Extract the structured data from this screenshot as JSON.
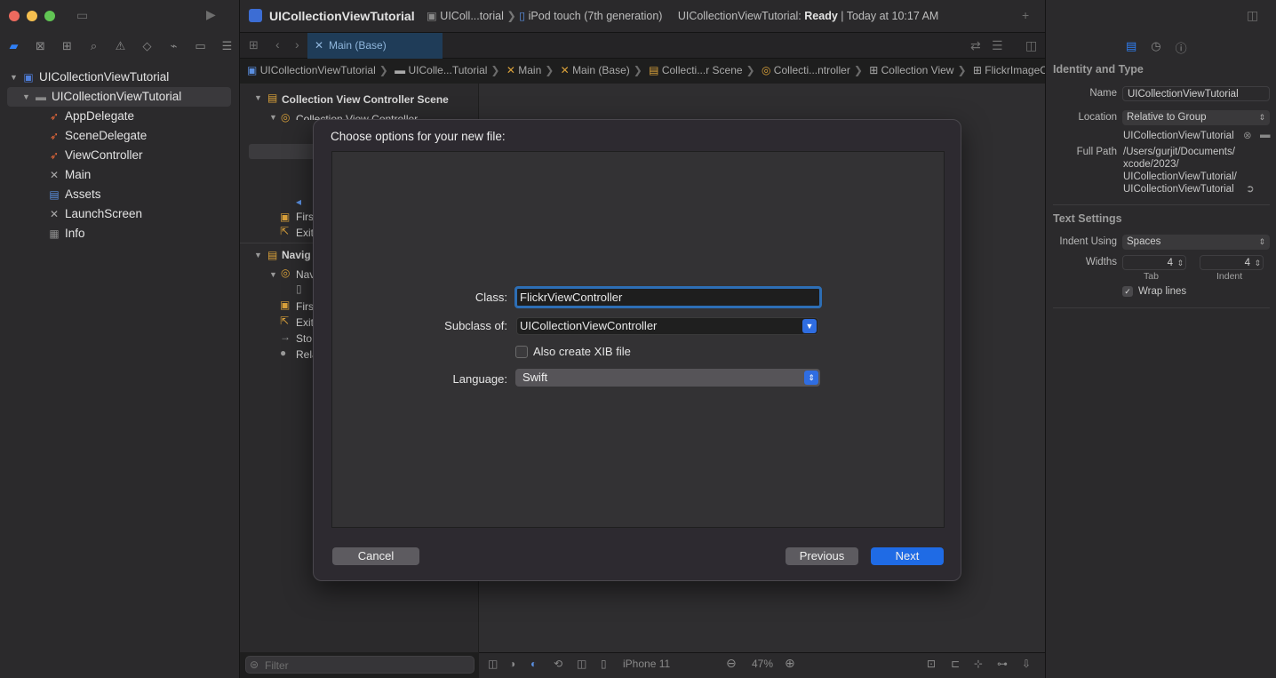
{
  "navigator": {
    "tree": [
      {
        "label": "UICollectionViewTutorial",
        "icon": "project-icon",
        "level": 0
      },
      {
        "label": "UICollectionViewTutorial",
        "icon": "folder-icon",
        "level": 1,
        "selected": true
      },
      {
        "label": "AppDelegate",
        "icon": "swift-file-icon",
        "level": 2
      },
      {
        "label": "SceneDelegate",
        "icon": "swift-file-icon",
        "level": 2
      },
      {
        "label": "ViewController",
        "icon": "swift-file-icon",
        "level": 2
      },
      {
        "label": "Main",
        "icon": "storyboard-icon",
        "level": 2
      },
      {
        "label": "Assets",
        "icon": "asset-catalog-icon",
        "level": 2
      },
      {
        "label": "LaunchScreen",
        "icon": "storyboard-icon",
        "level": 2
      },
      {
        "label": "Info",
        "icon": "plist-icon",
        "level": 2
      }
    ],
    "filter_placeholder": "Filter"
  },
  "toolbar": {
    "scheme_title": "UICollectionViewTutorial",
    "target_short": "UIColl...torial",
    "device": "iPod touch (7th generation)",
    "status_prefix": "UICollectionViewTutorial:",
    "status_state": "Ready",
    "status_time": "| Today at 10:17 AM"
  },
  "editor": {
    "tab_label": "Main (Base)",
    "breadcrumb": [
      "UICollectionViewTutorial",
      "UIColle...Tutorial",
      "Main",
      "Main (Base)",
      "Collecti...r Scene",
      "Collecti...ntroller",
      "Collection View",
      "FlickrImageCell"
    ],
    "outline": {
      "scene1": "Collection View Controller Scene",
      "scene1_controller": "Collection View Controller",
      "first_responder": "Firs",
      "exit": "Exit",
      "scene2": "Navig",
      "nav_item": "Navi",
      "storyboard_entry": "Sto",
      "relationship": "Rela"
    },
    "canvas_bar": {
      "device": "iPhone 11",
      "zoom": "47%"
    }
  },
  "inspector": {
    "identity_header": "Identity and Type",
    "name_label": "Name",
    "name_value": "UICollectionViewTutorial",
    "location_label": "Location",
    "location_value": "Relative to Group",
    "location_path": "UICollectionViewTutorial",
    "fullpath_label": "Full Path",
    "fullpath_lines": [
      "/Users/gurjit/Documents/",
      "xcode/2023/",
      "UICollectionViewTutorial/",
      "UICollectionViewTutorial"
    ],
    "text_settings_header": "Text Settings",
    "indent_using_label": "Indent Using",
    "indent_using_value": "Spaces",
    "widths_label": "Widths",
    "tab_value": "4",
    "indent_value": "4",
    "tab_caption": "Tab",
    "indent_caption": "Indent",
    "wrap_lines_label": "Wrap lines"
  },
  "sheet": {
    "title": "Choose options for your new file:",
    "class_label": "Class:",
    "class_value": "FlickrViewController",
    "subclass_label": "Subclass of:",
    "subclass_value": "UICollectionViewController",
    "xib_label": "Also create XIB file",
    "language_label": "Language:",
    "language_value": "Swift",
    "cancel_label": "Cancel",
    "previous_label": "Previous",
    "next_label": "Next"
  }
}
